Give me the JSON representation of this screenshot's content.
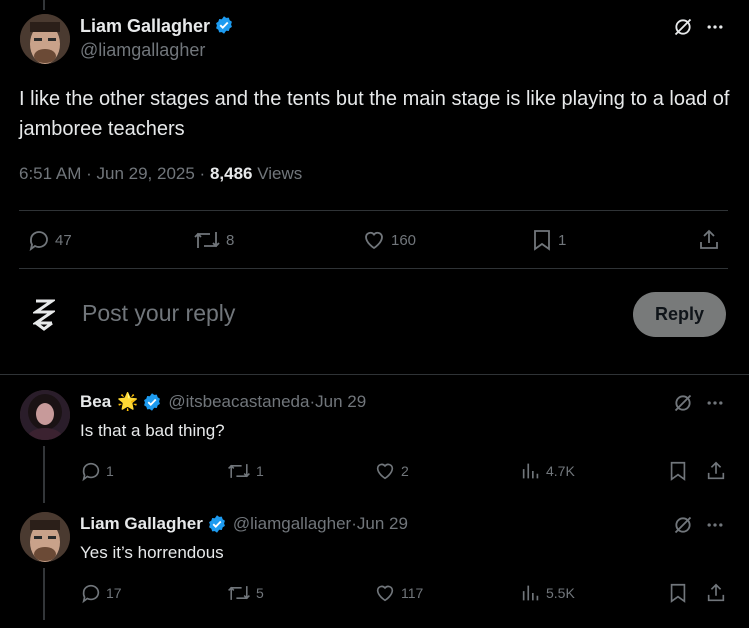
{
  "main_tweet": {
    "author_name": "Liam Gallagher",
    "author_handle": "@liamgallagher",
    "text": "I like the other stages and the tents but the main stage is like playing to a load of jamboree teachers",
    "time": "6:51 AM",
    "date": "Jun 29, 2025",
    "views_count": "8,486",
    "views_label": "Views",
    "replies": "47",
    "reposts": "8",
    "likes": "160",
    "bookmarks": "1"
  },
  "reply_box": {
    "placeholder": "Post your reply",
    "button_label": "Reply"
  },
  "replies": [
    {
      "author_name": "Bea",
      "emoji": "🌟",
      "author_handle": "@itsbeacastaneda",
      "date": "Jun 29",
      "text": "Is that a bad thing?",
      "replies": "1",
      "reposts": "1",
      "likes": "2",
      "views": "4.7K"
    },
    {
      "author_name": "Liam Gallagher",
      "author_handle": "@liamgallagher",
      "date": "Jun 29",
      "text": "Yes it’s horrendous",
      "replies": "17",
      "reposts": "5",
      "likes": "117",
      "views": "5.5K"
    }
  ],
  "colors": {
    "background": "#000000",
    "text": "#e7e9ea",
    "muted": "#71767b",
    "verified": "#1d9bf0",
    "divider": "#2f3336",
    "reply_button": "#787a7a"
  }
}
